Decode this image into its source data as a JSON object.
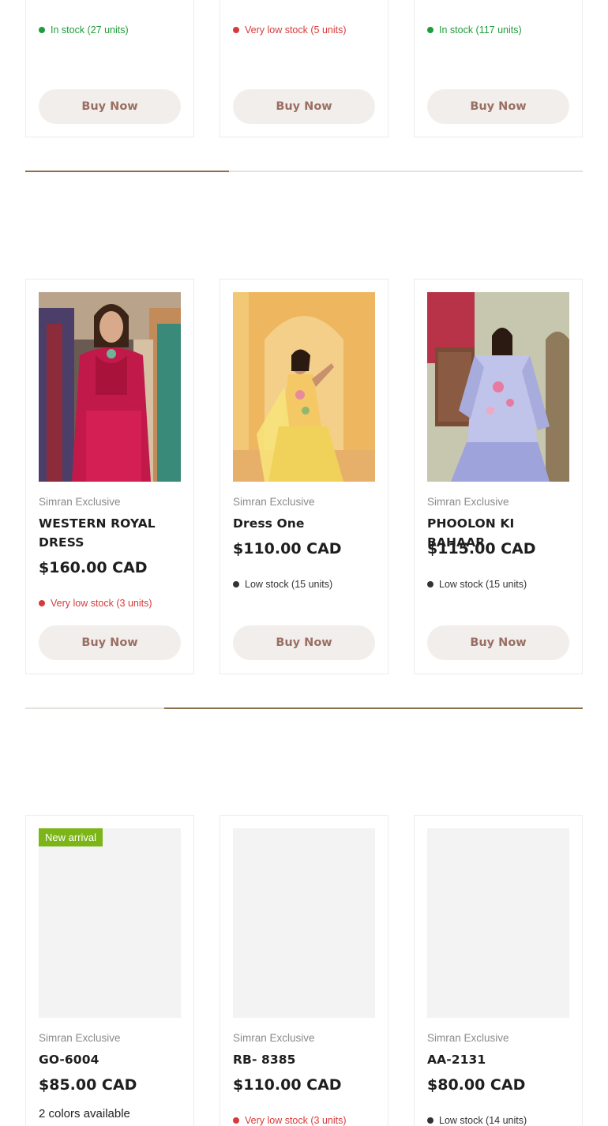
{
  "rows": [
    {
      "products": [
        {
          "vendor": "",
          "title": "",
          "price": "",
          "stock": "In stock (27 units)",
          "stock_level": "green",
          "buy_label": "Buy Now"
        },
        {
          "vendor": "",
          "title": "",
          "price": "",
          "stock": "Very low stock (5 units)",
          "stock_level": "red",
          "buy_label": "Buy Now"
        },
        {
          "vendor": "",
          "title": "",
          "price": "",
          "stock": "In stock (117 units)",
          "stock_level": "green",
          "buy_label": "Buy Now"
        }
      ],
      "scroll_position": 0.0,
      "scroll_thumb_fraction": 0.365
    },
    {
      "products": [
        {
          "vendor": "Simran Exclusive",
          "title": "WESTERN ROYAL DRESS",
          "price": "$160.00 CAD",
          "stock": "Very low stock (3 units)",
          "stock_level": "red",
          "buy_label": "Buy Now",
          "image": "dress-red"
        },
        {
          "vendor": "Simran Exclusive",
          "title": "Dress One",
          "price": "$110.00 CAD",
          "stock": "Low stock (15 units)",
          "stock_level": "dark",
          "buy_label": "Buy Now",
          "image": "dress-yellow"
        },
        {
          "vendor": "Simran Exclusive",
          "title": "PHOOLON KI BAHAAR",
          "price": "$115.00 CAD",
          "stock": "Low stock (15 units)",
          "stock_level": "dark",
          "buy_label": "Buy Now",
          "image": "dress-lavender"
        }
      ],
      "scroll_position": 0.25,
      "scroll_thumb_fraction": 0.75
    },
    {
      "products": [
        {
          "vendor": "Simran Exclusive",
          "title": "GO-6004",
          "price": "$85.00 CAD",
          "colors": "2 colors available",
          "badge": "New arrival",
          "image": "placeholder"
        },
        {
          "vendor": "Simran Exclusive",
          "title": "RB- 8385",
          "price": "$110.00 CAD",
          "stock": "Very low stock (3 units)",
          "stock_level": "red",
          "image": "placeholder"
        },
        {
          "vendor": "Simran Exclusive",
          "title": "AA-2131",
          "price": "$80.00 CAD",
          "stock": "Low stock (14 units)",
          "stock_level": "dark",
          "image": "placeholder"
        }
      ]
    }
  ],
  "colors": {
    "in_stock": "#1f9d3a",
    "very_low_stock": "#d83a3a",
    "low_stock": "#333333",
    "buy_button_bg": "#f2eeeb",
    "buy_button_text": "#9b6f63",
    "scroll_thumb": "#8b6e4e",
    "badge_bg": "#7cb518"
  }
}
